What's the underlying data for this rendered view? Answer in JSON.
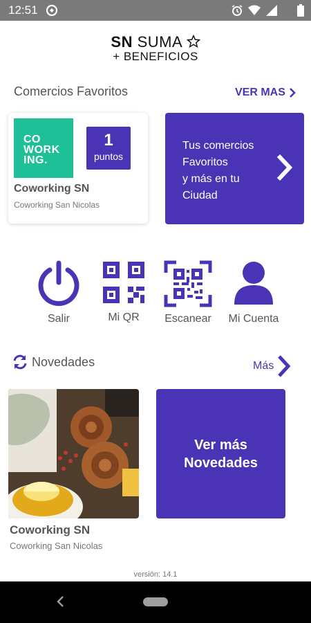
{
  "statusbar": {
    "time": "12:51"
  },
  "logo": {
    "line1_bold": "SN",
    "line1_rest": " SUMA",
    "line2": "+ BENEFICIOS"
  },
  "favorites": {
    "title": "Comercios Favoritos",
    "more_label": "VER MAS",
    "card": {
      "logo_lines": [
        "CO",
        "WORK",
        "ING."
      ],
      "points_value": "1",
      "points_label": "puntos",
      "name": "Coworking SN",
      "subtitle": "Coworking San Nicolas"
    },
    "promo_lines": [
      "Tus comercios",
      "Favoritos",
      "y más en tu",
      "Ciudad"
    ]
  },
  "actions": [
    {
      "label": "Salir",
      "icon": "power-icon"
    },
    {
      "label": "Mi QR",
      "icon": "qr-code-icon"
    },
    {
      "label": "Escanear",
      "icon": "scan-qr-icon"
    },
    {
      "label": "Mi Cuenta",
      "icon": "user-icon"
    }
  ],
  "news": {
    "title": "Novedades",
    "more_label": "Más",
    "card": {
      "name": "Coworking SN",
      "subtitle": "Coworking San Nicolas"
    },
    "button_lines": [
      "Ver más",
      "Novedades"
    ]
  },
  "footer": {
    "version": "versión: 14.1"
  },
  "colors": {
    "accent": "#4a34b5",
    "brand_green": "#1fc097",
    "statusbar": "#7a7a7a"
  }
}
